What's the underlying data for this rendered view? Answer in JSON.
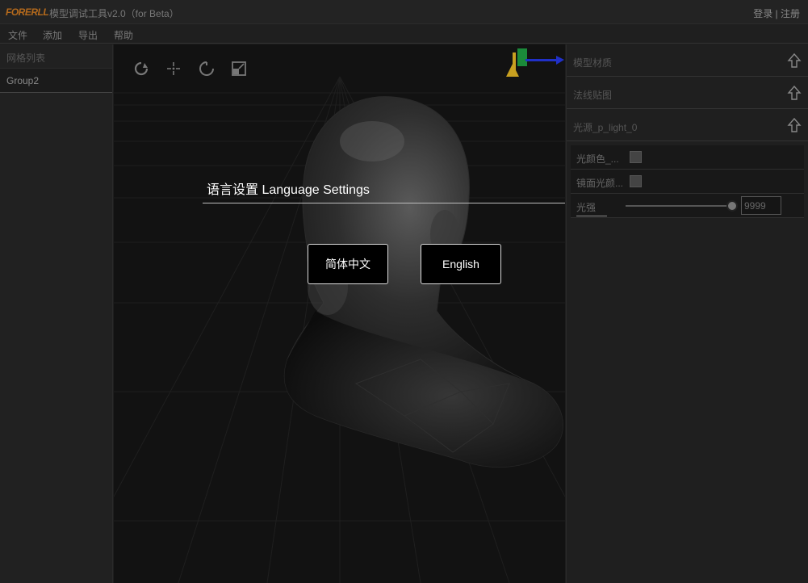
{
  "titlebar": {
    "logo": "FORERLL",
    "title": "模型调试工具v2.0（for Beta）",
    "auth": "登录 | 注册"
  },
  "menu": {
    "items": [
      "文件",
      "添加",
      "导出",
      "帮助"
    ]
  },
  "left_panel": {
    "header": "网格列表",
    "items": [
      "Group2"
    ]
  },
  "viewport": {
    "tools": [
      "rotate-icon",
      "move-icon",
      "refresh-icon",
      "scale-icon"
    ]
  },
  "right_panel": {
    "sections": [
      "模型材质",
      "法线贴图",
      "光源_p_light_0"
    ],
    "properties": {
      "light_color_label": "光颜色_...",
      "specular_color_label": "镜面光颜...",
      "intensity_label": "光强",
      "intensity_value": "9999",
      "intensity_level": 1.0
    }
  },
  "dialog": {
    "title": "语言设置 Language Settings",
    "chinese_label": "简体中文",
    "english_label": "English"
  },
  "colors": {
    "accent_logo": "#b56a1c",
    "background": "#121212",
    "panel": "#1f1f1f"
  }
}
